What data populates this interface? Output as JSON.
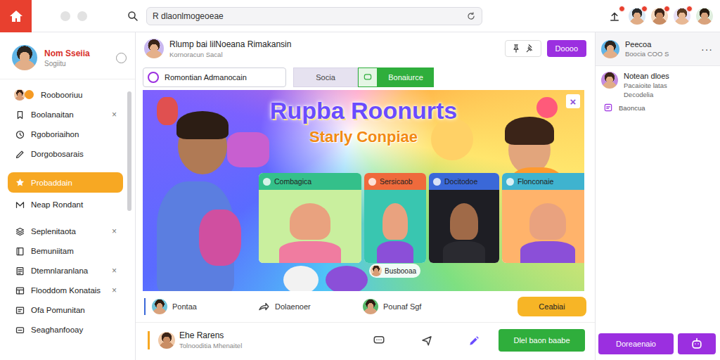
{
  "topbar": {
    "search": {
      "value": "R dlaonlmogeoeae"
    },
    "notifications": [
      {
        "badge": true
      },
      {
        "badge": true
      },
      {
        "badge": true
      },
      {
        "badge": true
      },
      {
        "badge": false
      }
    ]
  },
  "sidebar": {
    "profile": {
      "name": "Nom Sseiia",
      "subtitle": "Sogiitu"
    },
    "items": [
      {
        "label": "Roobooriuu",
        "selected": false,
        "badge": true
      },
      {
        "label": "Boolanaitan",
        "selected": false,
        "badge": false,
        "close": "×"
      },
      {
        "label": "Rgoboriaihon",
        "selected": false,
        "badge": false
      },
      {
        "label": "Dorgobosarais",
        "selected": false,
        "badge": false
      },
      {
        "label": "Probaddain",
        "selected": true,
        "badge": false
      },
      {
        "label": "Neap Rondant",
        "selected": false,
        "badge": false
      },
      {
        "label": "Seplenitaota",
        "selected": false,
        "badge": false,
        "close": "×"
      },
      {
        "label": "Bemuniitam",
        "selected": false,
        "badge": false
      },
      {
        "label": "Dtemnlaranlana",
        "selected": false,
        "badge": false,
        "close": "×"
      },
      {
        "label": "Flooddom Konatais",
        "selected": false,
        "badge": false,
        "close": "×"
      },
      {
        "label": "Ofa Pomunitan",
        "selected": false,
        "badge": false
      },
      {
        "label": "Seaghanfooay",
        "selected": false,
        "badge": false
      }
    ]
  },
  "main": {
    "header": {
      "title": "Rlump bai lilNoeana Rimakansin",
      "subtitle": "Kornoracun Sacal",
      "action": "Doooo"
    },
    "toolbar": {
      "field": "Romontian Admanocain",
      "tab": "Socia",
      "button": "Bonaiurce"
    },
    "banner": {
      "title": "Rupba Roonurts",
      "subtitle": "Starly Conpiae",
      "close": "×",
      "cards": [
        {
          "label": "Combagica",
          "color": "#34c08a"
        },
        {
          "label": "Sersicaob",
          "color": "#ef6a3c"
        },
        {
          "label": "Docitodoe",
          "color": "#3a68d8"
        },
        {
          "label": "Flonconaie",
          "color": "#3fb3cf"
        }
      ],
      "caption": "Busbooaa"
    },
    "actions": [
      {
        "label": "Pontaa"
      },
      {
        "label": "Dolaenoer"
      },
      {
        "label": "Pounaf Sgf"
      }
    ],
    "cta": "Ceabiai",
    "post": {
      "name": "Ehe Rarens",
      "subtitle": "Tolnooditia Mhenaitel",
      "button": "Dlel baon baabe"
    }
  },
  "right": {
    "header": {
      "name": "Peecoa",
      "subtitle": "Boocia COO S",
      "menu": "···"
    },
    "item": {
      "title": "Notean dloes",
      "lines": [
        "Pacaioite latas",
        "Decodelia"
      ],
      "link": "Baoncua"
    },
    "button": "Doreaenaio"
  }
}
